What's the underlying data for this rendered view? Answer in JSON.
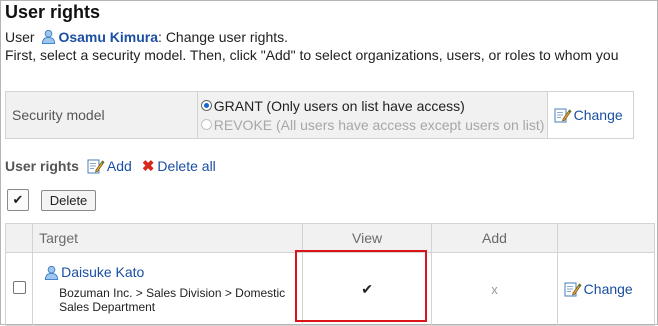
{
  "title": "User rights",
  "intro": {
    "prefix": "User",
    "user_name": "Osamu Kimura",
    "suffix": ": Change user rights.",
    "instruction": "First, select a security model. Then, click \"Add\" to select organizations, users, or roles to whom you"
  },
  "security_model": {
    "label": "Security model",
    "options": [
      {
        "label": "GRANT (Only users on list have access)",
        "selected": true
      },
      {
        "label": "REVOKE (All users have access except users on list)",
        "selected": false
      }
    ],
    "change_label": "Change"
  },
  "user_rights": {
    "title": "User rights",
    "add_label": "Add",
    "delete_all_label": "Delete all",
    "select_all_glyph": "✔",
    "delete_button": "Delete",
    "columns": {
      "target": "Target",
      "view": "View",
      "add": "Add"
    },
    "rows": [
      {
        "name": "Daisuke Kato",
        "path": "Bozuman Inc. > Sales Division > Domestic Sales Department",
        "view_glyph": "✔",
        "add_glyph": "x",
        "change_label": "Change"
      }
    ]
  },
  "colors": {
    "link": "#1a4fa3",
    "highlight": "#d9141a",
    "header_bg": "#f1f1f1",
    "radio_selected": "#1766d1"
  }
}
